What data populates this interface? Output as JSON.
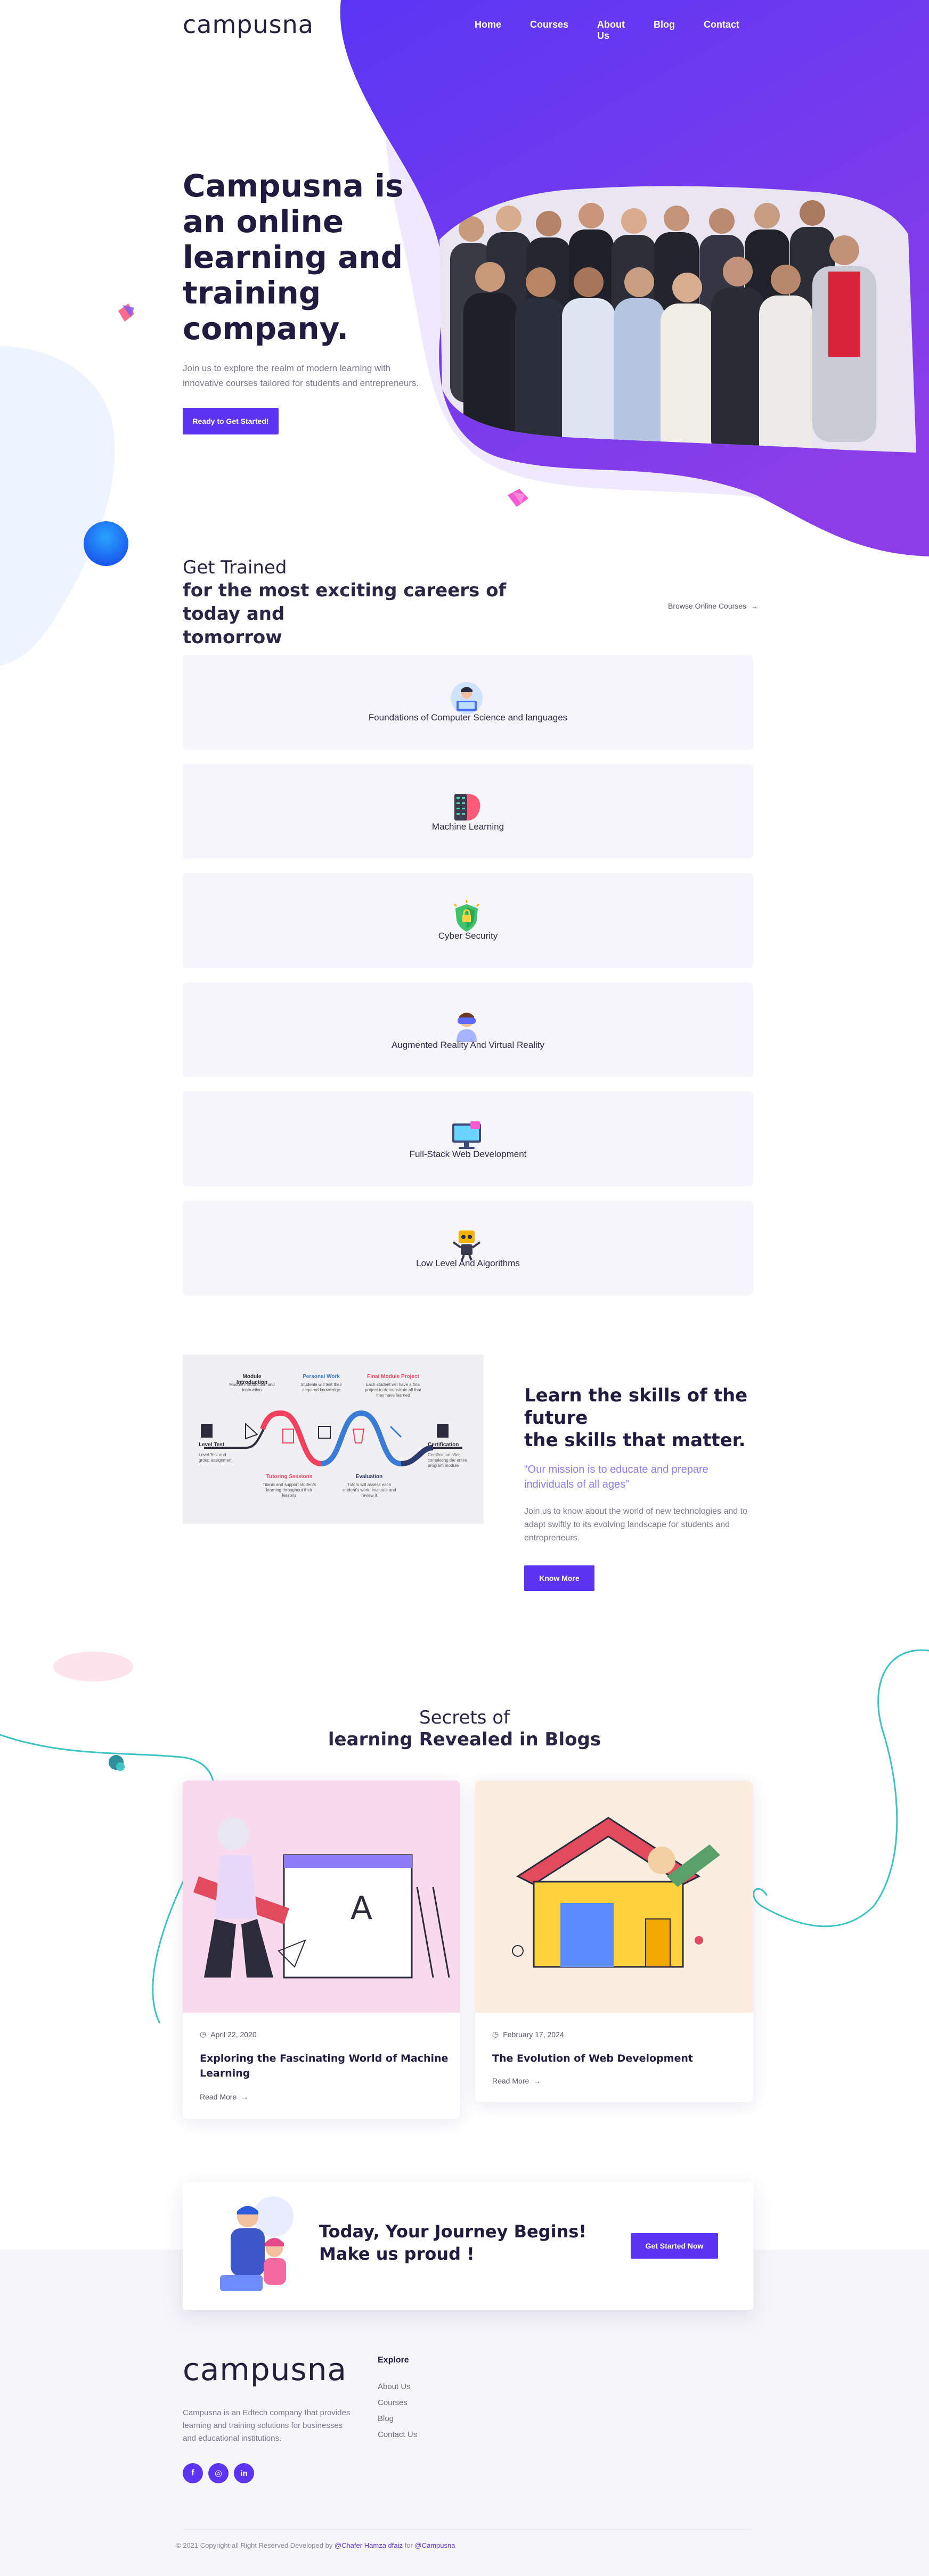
{
  "header": {
    "logo": "campusna",
    "nav": [
      "Home",
      "Courses",
      "About Us",
      "Blog",
      "Contact"
    ]
  },
  "hero": {
    "title_lines": [
      "Campusna is",
      "an online",
      "learning and",
      "training",
      "company."
    ],
    "subtitle_lines": [
      "Join us to explore the realm of modern learning with",
      "innovative courses tailored for students and entrepreneurs."
    ],
    "cta": "Ready to Get Started!"
  },
  "courses": {
    "heading_light": "Get Trained",
    "heading_bold_lines": [
      "for the most exciting careers of today and",
      "tomorrow"
    ],
    "browse_link": "Browse Online Courses",
    "items": [
      {
        "label": "Foundations of Computer Science and languages",
        "icon": "programmer-icon"
      },
      {
        "label": "Machine Learning",
        "icon": "brain-chip-icon"
      },
      {
        "label": "Cyber Security",
        "icon": "shield-icon"
      },
      {
        "label": "Augmented Reality And Virtual Reality",
        "icon": "vr-headset-icon"
      },
      {
        "label": "Full-Stack Web Development",
        "icon": "monitor-icon"
      },
      {
        "label": "Low Level And Algorithms",
        "icon": "robot-icon"
      }
    ]
  },
  "skills": {
    "infographic": {
      "steps_top": [
        "Module Introduction",
        "Personal Work",
        "Final Module Project"
      ],
      "steps_top_desc": [
        "Module introduction and instruction",
        "Students will test their acquired knowledge",
        "Each student will have a final project to demonstrate all that they have learned"
      ],
      "steps_bottom": [
        "Tutoring Sessions",
        "Evaluation"
      ],
      "steps_bottom_desc": [
        "Titanic and support students learning throughout their lessons",
        "Tutors will assess each student's work, evaluate and review it"
      ],
      "ends": [
        "Level Test",
        "Certification"
      ],
      "ends_desc": [
        "Level Test and group assignment",
        "Certification after completing the entire program module"
      ]
    },
    "title_lines": [
      "Learn the skills of the",
      "future",
      "the skills that matter."
    ],
    "quote_lines": [
      "“Our mission is to educate and prepare",
      "individuals of all ages”"
    ],
    "body_lines": [
      "Join us to know about the world of new technologies and to",
      "adapt swiftly to its evolving landscape for students and",
      "entrepreneurs."
    ],
    "cta": "Know More"
  },
  "blogs": {
    "heading_light": "Secrets of",
    "heading_bold": "learning Revealed in Blogs",
    "posts": [
      {
        "date": "April 22, 2020",
        "title_lines": [
          "Exploring the Fascinating World of Machine",
          "Learning"
        ],
        "read_more": "Read More"
      },
      {
        "date": "February 17, 2024",
        "title_lines": [
          "The Evolution of Web Development"
        ],
        "read_more": "Read More"
      }
    ]
  },
  "banner": {
    "title_lines": [
      "Today, Your Journey Begins!",
      "Make us proud !"
    ],
    "cta": "Get Started Now"
  },
  "footer": {
    "logo": "campusna",
    "about_lines": [
      "Campusna is an Edtech company that provides",
      "learning and training solutions for businesses",
      "and educational institutions."
    ],
    "explore_title": "Explore",
    "links": [
      "About Us",
      "Courses",
      "Blog",
      "Contact Us"
    ],
    "social": [
      "facebook-icon",
      "instagram-icon",
      "linkedin-icon"
    ],
    "copyright": {
      "prefix": "© 2021 Copyright all Right Reserved Developed by ",
      "author": "@Chafer Hamza dfaiz",
      "middle": " for ",
      "brand": "@Campusna"
    }
  },
  "colors": {
    "accent": "#5b35f2",
    "purple": "#7a3ff0",
    "dark": "#211c3f",
    "card": "#f6f5fb",
    "teal": "#3cc4c4"
  }
}
